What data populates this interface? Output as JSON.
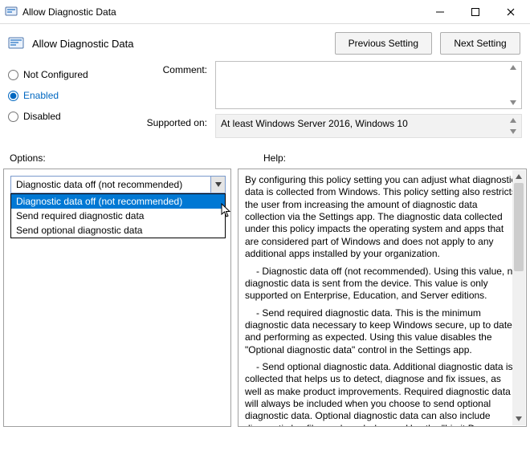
{
  "window": {
    "title": "Allow Diagnostic Data"
  },
  "header": {
    "title": "Allow Diagnostic Data",
    "prev": "Previous Setting",
    "next": "Next Setting"
  },
  "radios": {
    "not_configured": "Not Configured",
    "enabled": "Enabled",
    "disabled": "Disabled"
  },
  "labels": {
    "comment": "Comment:",
    "supported": "Supported on:",
    "options": "Options:",
    "help": "Help:"
  },
  "supported_on": "At least Windows Server 2016, Windows 10",
  "combo": {
    "selected": "Diagnostic data off (not recommended)"
  },
  "dropdown": {
    "items": [
      "Diagnostic data off (not recommended)",
      "Send required diagnostic data",
      "Send optional diagnostic data"
    ]
  },
  "help": {
    "p1": "By configuring this policy setting you can adjust what diagnostic data is collected from Windows. This policy setting also restricts the user from increasing the amount of diagnostic data collection via the Settings app. The diagnostic data collected under this policy impacts the operating system and apps that are considered part of Windows and does not apply to any additional apps installed by your organization.",
    "b1": "- Diagnostic data off (not recommended). Using this value, no diagnostic data is sent from the device. This value is only supported on Enterprise, Education, and Server editions.",
    "b2": "- Send required diagnostic data. This is the minimum diagnostic data necessary to keep Windows secure, up to date, and performing as expected. Using this value disables the \"Optional diagnostic data\" control in the Settings app.",
    "b3": "- Send optional diagnostic data. Additional diagnostic data is collected that helps us to detect, diagnose and fix issues, as well as make product improvements. Required diagnostic data will always be included when you choose to send optional diagnostic data.  Optional diagnostic data can also include diagnostic log files and crash dumps. Use the \"Limit Dump Collection\" and the"
  }
}
